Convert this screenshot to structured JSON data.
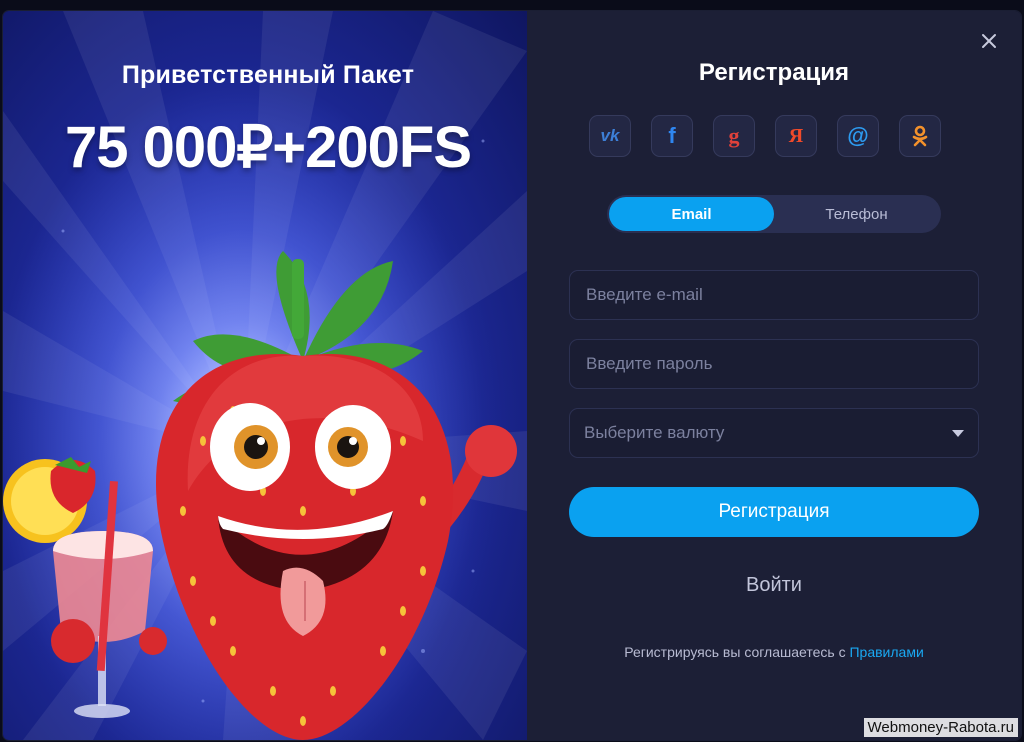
{
  "promo": {
    "title": "Приветственный Пакет",
    "amount": "75 000₽+200FS"
  },
  "registration": {
    "title": "Регистрация",
    "close_icon": "close-icon",
    "socials": [
      {
        "name": "vk",
        "icon": "vk-icon",
        "glyph": "vk",
        "color": "#3d7fd6"
      },
      {
        "name": "facebook",
        "icon": "facebook-icon",
        "glyph": "f",
        "color": "#2f86f0"
      },
      {
        "name": "google",
        "icon": "google-icon",
        "glyph": "g",
        "color": "#e0413a"
      },
      {
        "name": "yandex",
        "icon": "yandex-icon",
        "glyph": "Я",
        "color": "#f04a2a"
      },
      {
        "name": "mailru",
        "icon": "mail-at-icon",
        "glyph": "@",
        "color": "#2d9bf0"
      },
      {
        "name": "odnoklassniki",
        "icon": "odnoklassniki-icon",
        "glyph": "ok",
        "color": "#f3912b"
      }
    ],
    "tabs": [
      {
        "label": "Email",
        "active": true
      },
      {
        "label": "Телефон",
        "active": false
      }
    ],
    "email_placeholder": "Введите e-mail",
    "password_placeholder": "Введите пароль",
    "currency_placeholder": "Выберите валюту",
    "submit_label": "Регистрация",
    "login_label": "Войти",
    "terms_text": "Регистрируясь вы соглашаетесь с ",
    "terms_link": "Правилами"
  },
  "watermark": "Webmoney-Rabota.ru",
  "colors": {
    "accent": "#0aa1f0",
    "panel_bg": "#1c1f36",
    "promo_bg": "#2a3ab8"
  }
}
